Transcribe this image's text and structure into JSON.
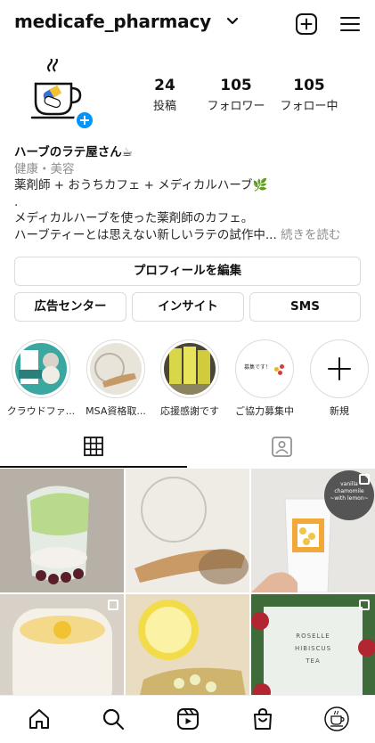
{
  "header": {
    "username": "medicafe_pharmacy"
  },
  "stats": [
    {
      "num": "24",
      "label": "投稿"
    },
    {
      "num": "105",
      "label": "フォロワー"
    },
    {
      "num": "105",
      "label": "フォロー中"
    }
  ],
  "bio": {
    "name": "ハーブのラテ屋さん☕",
    "category": "健康・美容",
    "line1": "薬剤師 + おうちカフェ + メディカルハーブ🌿",
    "line2": ".",
    "line3": "メディカルハーブを使った薬剤師のカフェ。",
    "line4": "ハーブティーとは思えない新しいラテの試作中...",
    "more": " 続きを読む"
  },
  "buttons": {
    "edit_profile": "プロフィールを編集",
    "ads": "広告センター",
    "insights": "インサイト",
    "sms": "SMS"
  },
  "highlights": [
    {
      "label": "クラウドファ..."
    },
    {
      "label": "MSA資格取..."
    },
    {
      "label": "応援感謝です"
    },
    {
      "label": "ご協力募集中",
      "inner_text": "募集です！"
    },
    {
      "label": "新規"
    }
  ],
  "posts": [
    {
      "subject": "whipped latte with red beans"
    },
    {
      "subject": "glass teapot and wooden spoon"
    },
    {
      "subject": "paper cup with label",
      "overlay_text": "vanilla\nchamomile\n~with lemon~"
    },
    {
      "subject": "pudding with chamomile"
    },
    {
      "subject": "lemon and dried chamomile"
    },
    {
      "subject": "roselle hibiscus",
      "overlay_text": "ROSELLE\nHIBISCUS\nTEA"
    }
  ],
  "colors": {
    "accent": "#0095f6",
    "border": "#dbdbdb",
    "muted": "#8e8e8e"
  }
}
